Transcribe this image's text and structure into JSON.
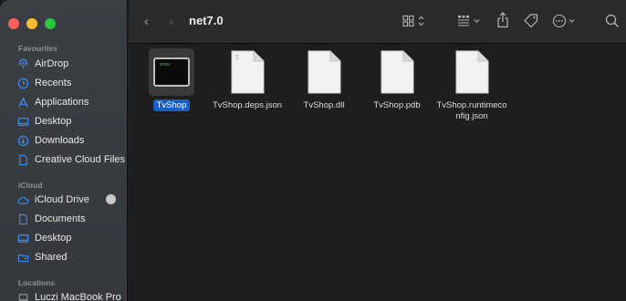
{
  "sidebar": {
    "sections": {
      "favourites": "Favourites",
      "icloud": "iCloud",
      "locations": "Locations"
    },
    "favourites": [
      {
        "label": "AirDrop",
        "icon": "airdrop-icon"
      },
      {
        "label": "Recents",
        "icon": "clock-icon"
      },
      {
        "label": "Applications",
        "icon": "applications-icon"
      },
      {
        "label": "Desktop",
        "icon": "desktop-icon"
      },
      {
        "label": "Downloads",
        "icon": "download-icon"
      },
      {
        "label": "Creative Cloud Files",
        "icon": "document-icon"
      }
    ],
    "icloud": [
      {
        "label": "iCloud Drive",
        "icon": "cloud-icon"
      },
      {
        "label": "Documents",
        "icon": "document-icon"
      },
      {
        "label": "Desktop",
        "icon": "desktop-icon"
      },
      {
        "label": "Shared",
        "icon": "shared-folder-icon"
      }
    ],
    "locations": [
      {
        "label": "Luczi MacBook Pro",
        "icon": "laptop-icon"
      }
    ]
  },
  "toolbar": {
    "title": "net7.0",
    "back": "‹",
    "forward": "›"
  },
  "files": [
    {
      "name": "TvShop",
      "type": "exec",
      "badge": "exec",
      "selected": true
    },
    {
      "name": "TvShop.deps.json",
      "type": "document"
    },
    {
      "name": "TvShop.dll",
      "type": "document"
    },
    {
      "name": "TvShop.pdb",
      "type": "document"
    },
    {
      "name": "TvShop.runtimeconfig.json",
      "name_line1": "TvShop.runtimeco",
      "name_line2": "nfig.json",
      "type": "document"
    }
  ],
  "colors": {
    "accent": "#1a5fc9",
    "sidebar_icon": "#3c8cf0"
  }
}
